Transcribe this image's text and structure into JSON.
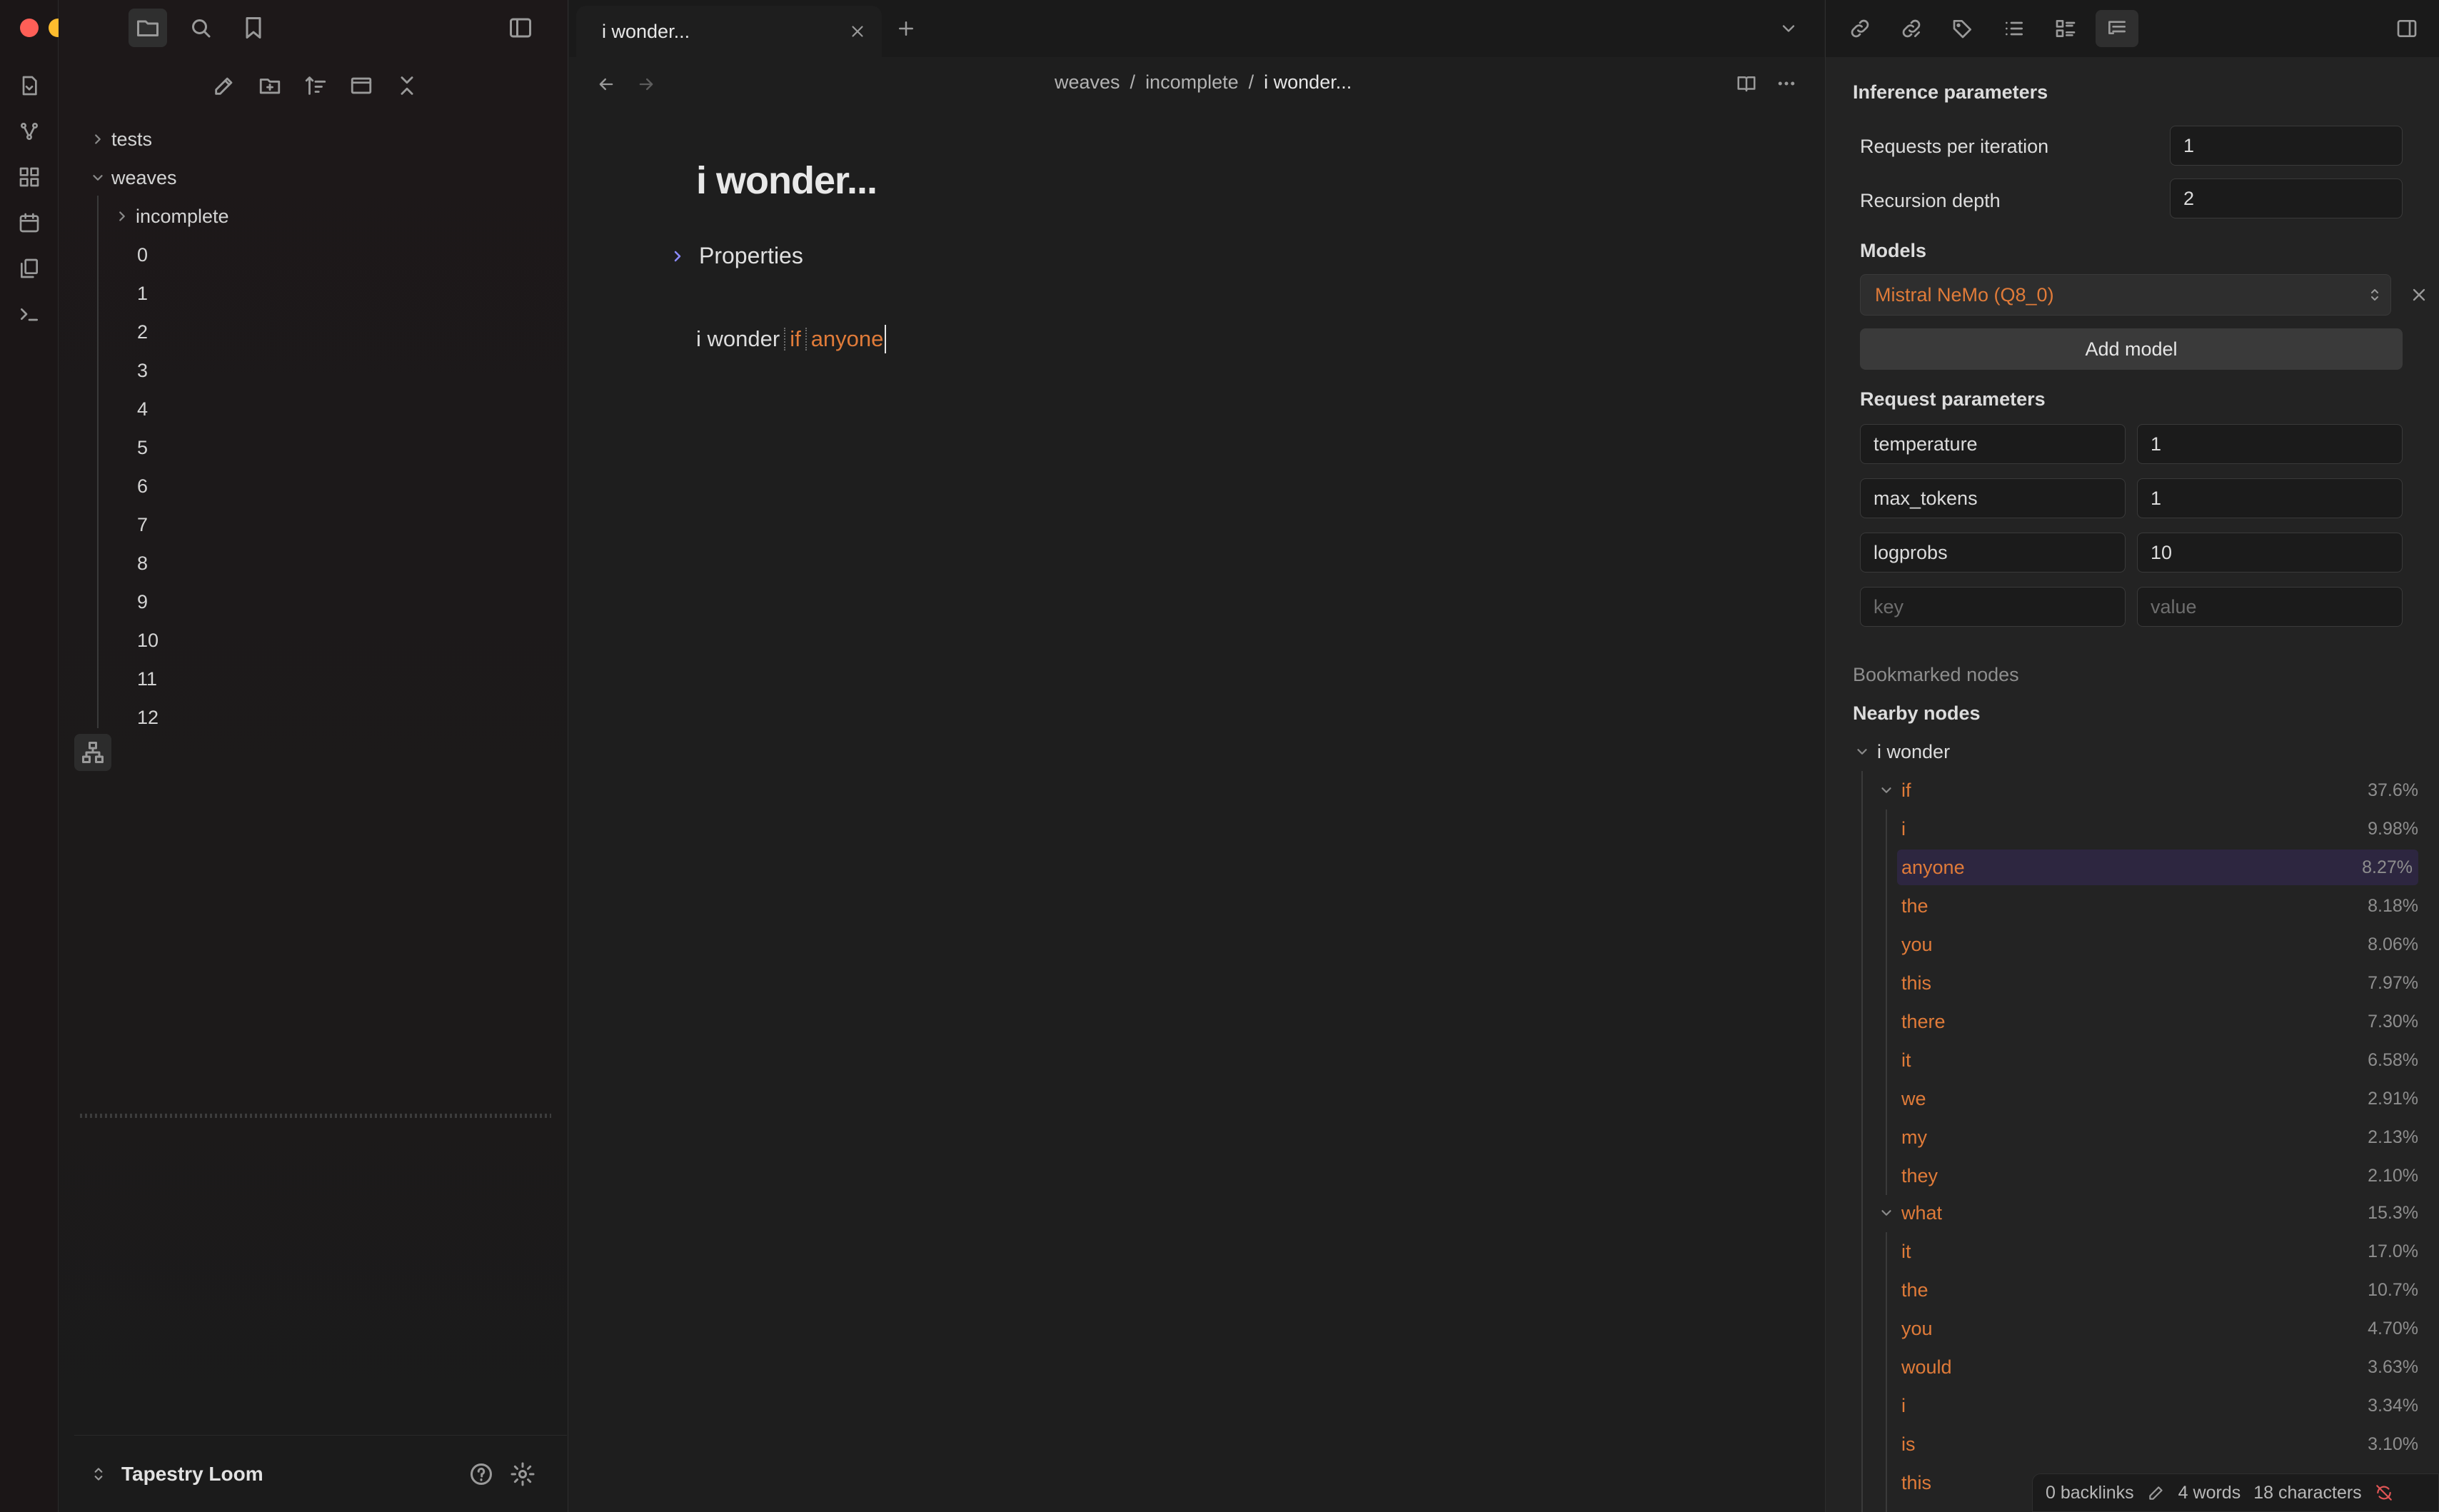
{
  "window": {
    "traffic_colors": [
      "#ff5f57",
      "#febc2e",
      "#28c840"
    ]
  },
  "explorer": {
    "tree": [
      {
        "label": "tests",
        "kind": "folder",
        "expanded": false
      },
      {
        "label": "weaves",
        "kind": "folder",
        "expanded": true
      },
      {
        "label": "incomplete",
        "kind": "folder",
        "expanded": false
      },
      {
        "label": "0"
      },
      {
        "label": "1"
      },
      {
        "label": "2"
      },
      {
        "label": "3"
      },
      {
        "label": "4"
      },
      {
        "label": "5"
      },
      {
        "label": "6"
      },
      {
        "label": "7"
      },
      {
        "label": "8"
      },
      {
        "label": "9"
      },
      {
        "label": "10"
      },
      {
        "label": "11"
      },
      {
        "label": "12"
      }
    ],
    "vault_name": "Tapestry Loom"
  },
  "editor": {
    "tab_title": "i wonder...",
    "breadcrumb": [
      "weaves",
      "incomplete",
      "i wonder..."
    ],
    "breadcrumb_sep": "/",
    "note_title": "i wonder...",
    "properties_label": "Properties",
    "body": {
      "prefix": "i wonder",
      "generated": [
        " if",
        " anyone"
      ]
    }
  },
  "inference": {
    "title": "Inference parameters",
    "requests_label": "Requests per iteration",
    "requests_value": "1",
    "depth_label": "Recursion depth",
    "depth_value": "2",
    "models_label": "Models",
    "model_selected": "Mistral NeMo (Q8_0)",
    "add_model_label": "Add model",
    "request_params_label": "Request parameters",
    "params": [
      {
        "key": "temperature",
        "value": "1"
      },
      {
        "key": "max_tokens",
        "value": "1"
      },
      {
        "key": "logprobs",
        "value": "10"
      }
    ],
    "key_placeholder": "key",
    "value_placeholder": "value"
  },
  "nodes": {
    "bookmarked_label": "Bookmarked nodes",
    "nearby_label": "Nearby nodes",
    "root": "i wonder",
    "groups": [
      {
        "label": "if",
        "prob": "37.6%",
        "children": [
          {
            "label": "i",
            "prob": "9.98%"
          },
          {
            "label": "anyone",
            "prob": "8.27%",
            "selected": true
          },
          {
            "label": "the",
            "prob": "8.18%"
          },
          {
            "label": "you",
            "prob": "8.06%"
          },
          {
            "label": "this",
            "prob": "7.97%"
          },
          {
            "label": "there",
            "prob": "7.30%"
          },
          {
            "label": "it",
            "prob": "6.58%"
          },
          {
            "label": "we",
            "prob": "2.91%"
          },
          {
            "label": "my",
            "prob": "2.13%"
          },
          {
            "label": "they",
            "prob": "2.10%"
          }
        ]
      },
      {
        "label": "what",
        "prob": "15.3%",
        "children": [
          {
            "label": "it",
            "prob": "17.0%"
          },
          {
            "label": "the",
            "prob": "10.7%"
          },
          {
            "label": "you",
            "prob": "4.70%"
          },
          {
            "label": "would",
            "prob": "3.63%"
          },
          {
            "label": "i",
            "prob": "3.34%"
          },
          {
            "label": "is",
            "prob": "3.10%"
          },
          {
            "label": "this",
            "prob": ""
          }
        ]
      }
    ]
  },
  "status": {
    "backlinks": "0 backlinks",
    "words": "4 words",
    "characters": "18 characters"
  },
  "colors": {
    "accent": "#e07b39",
    "selected_row": "#2d2640",
    "bg": "#1e1e1e"
  }
}
